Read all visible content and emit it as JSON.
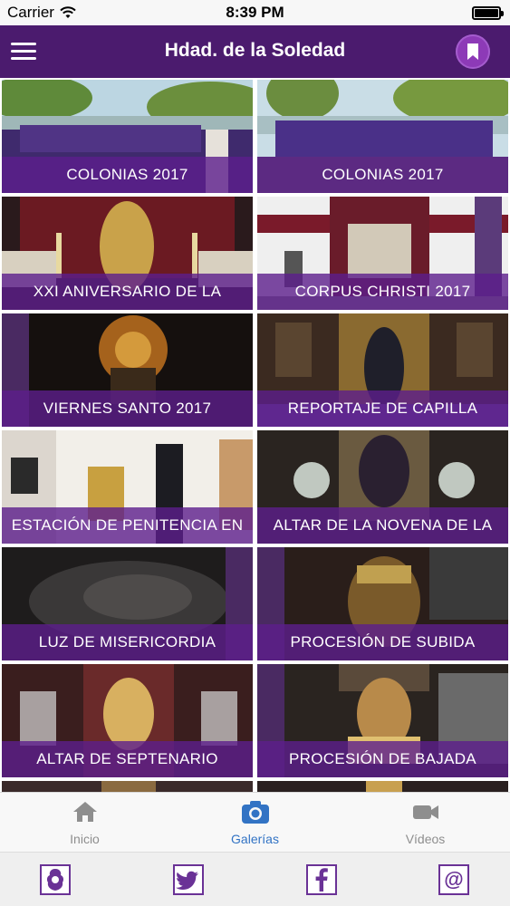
{
  "status_bar": {
    "carrier": "Carrier",
    "time": "8:39 PM"
  },
  "nav": {
    "title": "Hdad. de la Soledad",
    "menu_icon": "hamburger-menu-icon",
    "bookmark_icon": "bookmark-icon"
  },
  "colors": {
    "primary": "#4b1b6e",
    "accent": "#8d3ab7",
    "caption_overlay": "#5d1e8c",
    "active_tab": "#3273c4"
  },
  "gallery": [
    {
      "label": "COLONIAS 2017"
    },
    {
      "label": "COLONIAS 2017"
    },
    {
      "label": "XXI ANIVERSARIO DE LA"
    },
    {
      "label": "CORPUS CHRISTI 2017"
    },
    {
      "label": "VIERNES SANTO 2017"
    },
    {
      "label": "REPORTAJE DE CAPILLA"
    },
    {
      "label": "ESTACIÓN DE PENITENCIA EN"
    },
    {
      "label": "ALTAR DE LA NOVENA DE LA"
    },
    {
      "label": "LUZ DE MISERICORDIA"
    },
    {
      "label": "PROCESIÓN DE SUBIDA"
    },
    {
      "label": "ALTAR DE SEPTENARIO"
    },
    {
      "label": "PROCESIÓN DE BAJADA"
    }
  ],
  "tabs": [
    {
      "label": "Inicio",
      "icon": "home-icon"
    },
    {
      "label": "Galerías",
      "icon": "camera-icon",
      "active": true
    },
    {
      "label": "Vídeos",
      "icon": "video-camera-icon"
    }
  ],
  "social": [
    {
      "icon": "brotherhood-crest-icon"
    },
    {
      "icon": "twitter-icon"
    },
    {
      "icon": "facebook-icon"
    },
    {
      "icon": "email-at-icon",
      "glyph": "@"
    }
  ]
}
